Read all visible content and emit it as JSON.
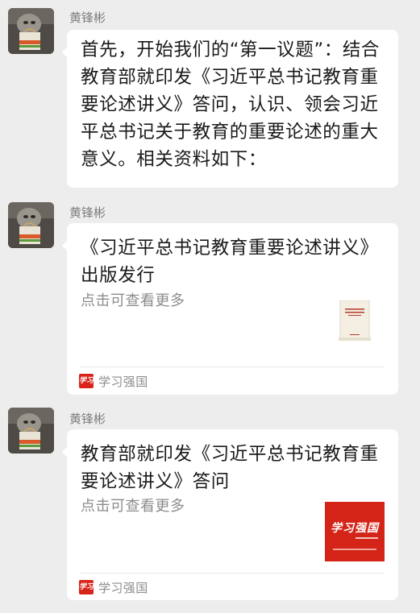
{
  "colors": {
    "background": "#ededed",
    "bubble": "#ffffff",
    "sender": "#7d7d7d",
    "secondary_text": "#8c8c8c",
    "brand_red": "#d8241a"
  },
  "messages": [
    {
      "sender": "黄锋彬",
      "type": "text",
      "text": "首先，开始我们的“第一议题”：结合教育部就印发《习近平总书记教育重要论述讲义》答问，认识、领会习近平总书记关于教育的重要论述的重大意义。相关资料如下："
    },
    {
      "sender": "黄锋彬",
      "type": "link-card",
      "title": "《习近平总书记教育重要论述讲义》出版发行",
      "desc": "点击可查看更多",
      "thumb_icon": "book-cover-icon",
      "source": "学习强国",
      "source_logo_text": "学习"
    },
    {
      "sender": "黄锋彬",
      "type": "link-card",
      "title": "教育部就印发《习近平总书记教育重要论述讲义》答问",
      "desc": "点击可查看更多",
      "thumb_icon": "xuexi-qiangguo-logo-icon",
      "thumb_text": "学习强国",
      "source": "学习强国",
      "source_logo_text": "学习"
    }
  ]
}
